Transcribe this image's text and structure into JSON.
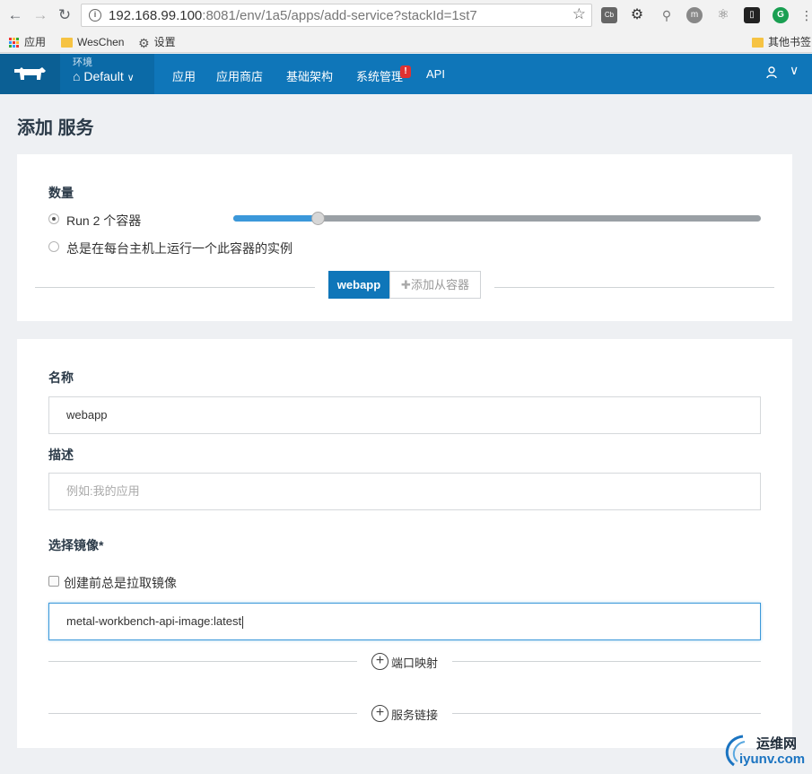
{
  "browser": {
    "url_host": "192.168.99.100",
    "url_rest": ":8081/env/1a5/apps/add-service?stackId=1st7",
    "bookmarks": [
      "应用",
      "WesChen",
      "设置"
    ],
    "other_bookmarks": "其他书签"
  },
  "header": {
    "env_label": "环境",
    "env_name": "Default",
    "nav": [
      "应用",
      "应用商店",
      "基础架构",
      "系统管理",
      "API"
    ],
    "alert_badge": "!"
  },
  "page": {
    "title": "添加 服务"
  },
  "scale": {
    "label": "数量",
    "option_run": "Run 2 个容器",
    "option_global": "总是在每台主机上运行一个此容器的实例",
    "slider_fraction": 0.16,
    "tab_active": "webapp",
    "tab_add": "添加从容器"
  },
  "form": {
    "name_label": "名称",
    "name_value": "webapp",
    "desc_label": "描述",
    "desc_placeholder": "例如:我的应用",
    "image_label": "选择镜像*",
    "pull_label": "创建前总是拉取镜像",
    "image_value": "metal-workbench-api-image:latest",
    "port_map": "端口映射",
    "service_link": "服务链接"
  },
  "watermark": {
    "top": "运维网",
    "bottom": "iyunv.com"
  }
}
